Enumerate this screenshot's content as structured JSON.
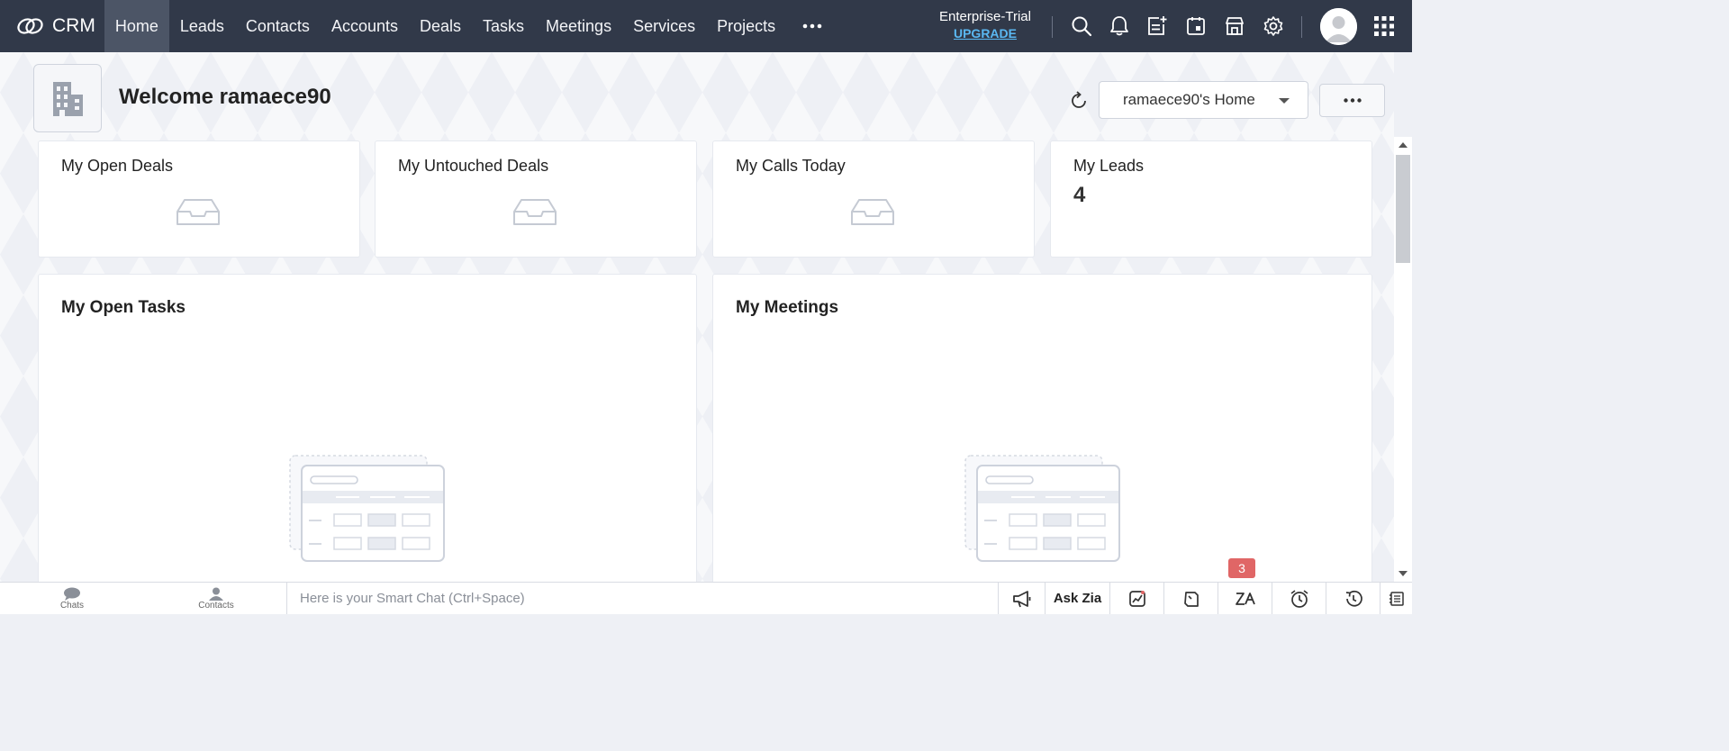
{
  "brand": {
    "name": "CRM"
  },
  "nav": {
    "tabs": [
      {
        "label": "Home",
        "active": true
      },
      {
        "label": "Leads"
      },
      {
        "label": "Contacts"
      },
      {
        "label": "Accounts"
      },
      {
        "label": "Deals"
      },
      {
        "label": "Tasks"
      },
      {
        "label": "Meetings"
      },
      {
        "label": "Services"
      },
      {
        "label": "Projects"
      }
    ],
    "more_icon": "more-horizontal-icon"
  },
  "trial": {
    "edition": "Enterprise-Trial",
    "upgrade": "UPGRADE"
  },
  "top_icons": [
    "search-icon",
    "bell-icon",
    "add-note-icon",
    "calendar-icon",
    "marketplace-icon",
    "gear-icon",
    "avatar",
    "apps-grid-icon"
  ],
  "welcome": {
    "text": "Welcome ramaece90"
  },
  "home_selector": {
    "value": "ramaece90's Home"
  },
  "cards": {
    "open_deals": {
      "title": "My Open Deals"
    },
    "untouched_deals": {
      "title": "My Untouched Deals"
    },
    "calls_today": {
      "title": "My Calls Today"
    },
    "leads": {
      "title": "My Leads",
      "value": "4"
    }
  },
  "panels": {
    "tasks": {
      "title": "My Open Tasks"
    },
    "meetings": {
      "title": "My Meetings"
    }
  },
  "bottombar": {
    "chats": "Chats",
    "contacts": "Contacts",
    "smartchat_placeholder": "Here is your Smart Chat (Ctrl+Space)",
    "ask_zia": "Ask Zia",
    "notification_count": "3"
  },
  "colors": {
    "nav_bg": "#313949",
    "nav_active": "#4c5566",
    "upgrade_link": "#5ab8f2",
    "badge": "#e06666"
  }
}
